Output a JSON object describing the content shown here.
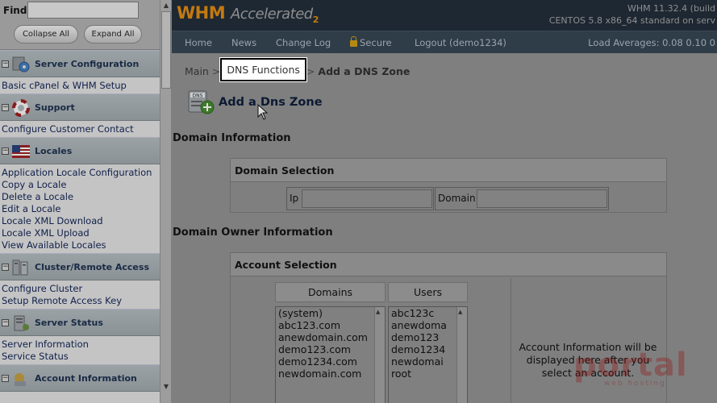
{
  "sidebar": {
    "find_label": "Find",
    "collapse_label": "Collapse All",
    "expand_label": "Expand All",
    "sections": [
      {
        "title": "Server Configuration",
        "icon": "gear-globe-icon",
        "links": [
          "Basic cPanel & WHM Setup"
        ]
      },
      {
        "title": "Support",
        "icon": "lifebuoy-icon",
        "links": [
          "Configure Customer Contact"
        ]
      },
      {
        "title": "Locales",
        "icon": "us-flag-icon",
        "links": [
          "Application Locale Configuration",
          "Copy a Locale",
          "Delete a Locale",
          "Edit a Locale",
          "Locale XML Download",
          "Locale XML Upload",
          "View Available Locales"
        ]
      },
      {
        "title": "Cluster/Remote Access",
        "icon": "server-cluster-icon",
        "links": [
          "Configure Cluster",
          "Setup Remote Access Key"
        ]
      },
      {
        "title": "Server Status",
        "icon": "server-status-icon",
        "links": [
          "Server Information",
          "Service Status"
        ]
      },
      {
        "title": "Account Information",
        "icon": "account-info-icon",
        "links": []
      }
    ]
  },
  "header": {
    "logo_whm": "WHM",
    "logo_accel": "Accelerated",
    "logo_two": "2",
    "server_line1": "WHM 11.32.4 (build",
    "server_line2": "CENTOS 5.8 x86_64 standard on serv",
    "nav": [
      "Home",
      "News",
      "Change Log",
      "Secure",
      "Logout (demo1234)"
    ],
    "load_avg": "Load Averages: 0.08 0.10 0"
  },
  "breadcrumb": {
    "main": "Main",
    "sep": ">",
    "dns": "DNS Functions",
    "current": "Add a DNS Zone"
  },
  "page": {
    "title": "Add a Dns Zone",
    "dns_icon_text": "DNS",
    "domain_info_heading": "Domain Information",
    "domain_selection_heading": "Domain Selection",
    "ip_label": "Ip",
    "ip_value": "",
    "domain_label": "Domain",
    "domain_value": "",
    "owner_info_heading": "Domain Owner Information",
    "account_selection_heading": "Account Selection",
    "domains_col": "Domains",
    "users_col": "Users",
    "domains": [
      "(system)",
      "abc123.com",
      "anewdomain.com",
      "demo123.com",
      "demo1234.com",
      "newdomain.com"
    ],
    "users": [
      "abc123c",
      "anewdoma",
      "demo123",
      "demo1234",
      "newdomai",
      "root"
    ],
    "account_info_text": "Account Information will be displayed here after you select an account."
  },
  "watermark": {
    "brand": "portal",
    "sub": "web hosting"
  },
  "colors": {
    "logo_orange": "#c47a10",
    "topbar": "#1e2833",
    "navbar": "#2f3d48",
    "highlight_border": "#000000"
  }
}
